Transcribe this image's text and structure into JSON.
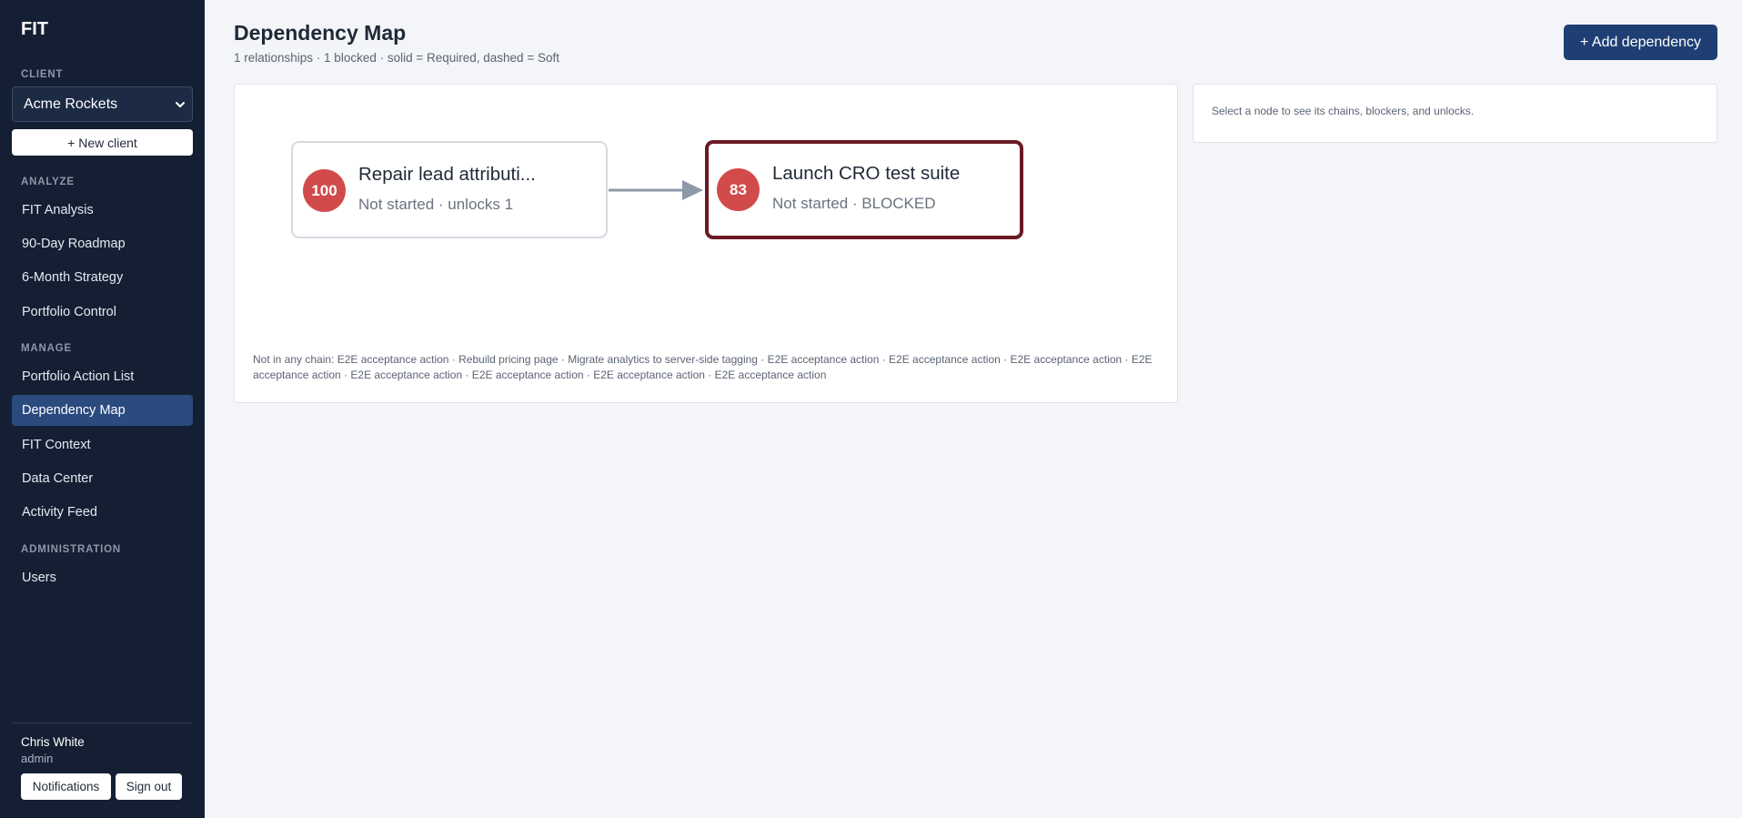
{
  "app": {
    "brand": "FIT"
  },
  "sidebar": {
    "client_label": "CLIENT",
    "client_selected": "Acme Rockets",
    "new_client": "+ New client",
    "analyze_label": "ANALYZE",
    "analyze_items": [
      "FIT Analysis",
      "90-Day Roadmap",
      "6-Month Strategy",
      "Portfolio Control"
    ],
    "manage_label": "MANAGE",
    "manage_items": [
      "Portfolio Action List",
      "Dependency Map",
      "FIT Context",
      "Data Center",
      "Activity Feed"
    ],
    "admin_label": "ADMINISTRATION",
    "admin_items": [
      "Users"
    ],
    "active_item": "Dependency Map",
    "user": {
      "name": "Chris White",
      "role": "admin"
    },
    "notifications": "Notifications",
    "sign_out": "Sign out"
  },
  "header": {
    "title": "Dependency Map",
    "subtitle": "1 relationships · 1 blocked · solid = Required, dashed = Soft",
    "add_button": "+ Add dependency"
  },
  "map": {
    "nodes": [
      {
        "score": "100",
        "title": "Repair lead attributi...",
        "status": "Not started · unlocks 1"
      },
      {
        "score": "83",
        "title": "Launch CRO test suite",
        "status": "Not started · BLOCKED"
      }
    ],
    "edge": {
      "type": "Required"
    },
    "not_in_chain": "Not in any chain: E2E acceptance action · Rebuild pricing page · Migrate analytics to server-side tagging · E2E acceptance action · E2E acceptance action · E2E acceptance action · E2E acceptance action · E2E acceptance action · E2E acceptance action · E2E acceptance action · E2E acceptance action"
  },
  "side_panel": {
    "hint": "Select a node to see its chains, blockers, and unlocks."
  },
  "colors": {
    "sidebar_bg": "#141f33",
    "active_nav": "#2b4a7e",
    "primary_button": "#1f3f74",
    "score_badge": "#d24b4b",
    "blocked_border": "#6b1a23",
    "edge": "#8d98a8"
  }
}
